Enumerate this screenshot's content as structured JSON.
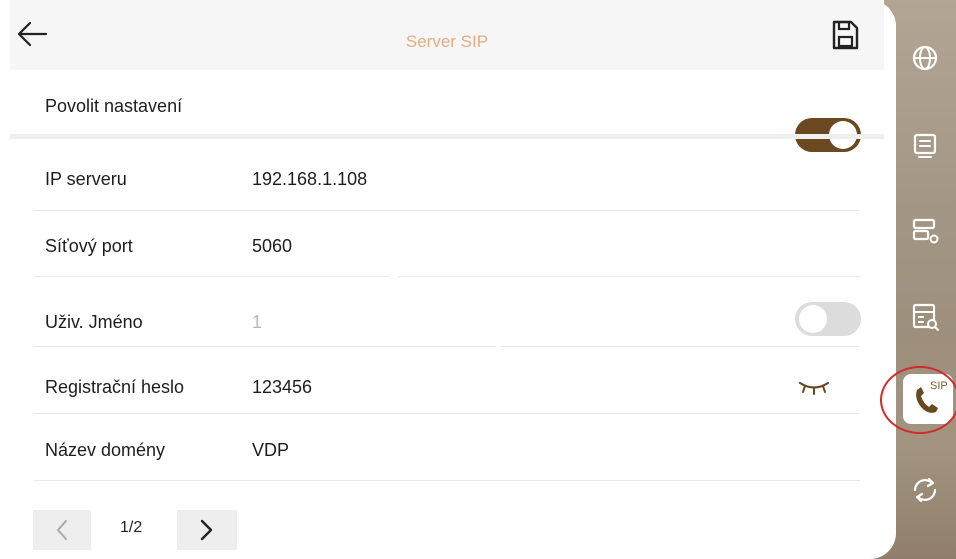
{
  "header": {
    "title": "Server SIP"
  },
  "settings": {
    "enable": {
      "label": "Povolit nastavení",
      "enabled": true
    },
    "rows": [
      {
        "label": "IP serveru",
        "value": "192.168.1.108"
      },
      {
        "label": "Síťový port",
        "value": "5060"
      },
      {
        "label": "Uživ. Jméno",
        "value": "1",
        "toggle_enabled": false
      },
      {
        "label": "Registrační heslo",
        "value": "123456"
      },
      {
        "label": "Název domény",
        "value": "VDP"
      }
    ]
  },
  "pagination": {
    "indicator": "1/2"
  },
  "sidebar": {
    "items": [
      {
        "icon": "globe-icon"
      },
      {
        "icon": "list-screen-icon"
      },
      {
        "icon": "server-settings-icon"
      },
      {
        "icon": "server-search-icon"
      },
      {
        "icon": "sip-phone-icon",
        "label": "SIP",
        "active": true
      },
      {
        "icon": "sync-icon"
      }
    ]
  },
  "colors": {
    "title": "#e3ad80",
    "toggle_on": "#6a4820",
    "toggle_off": "#dcdcdc",
    "highlight": "#d12b2b"
  }
}
